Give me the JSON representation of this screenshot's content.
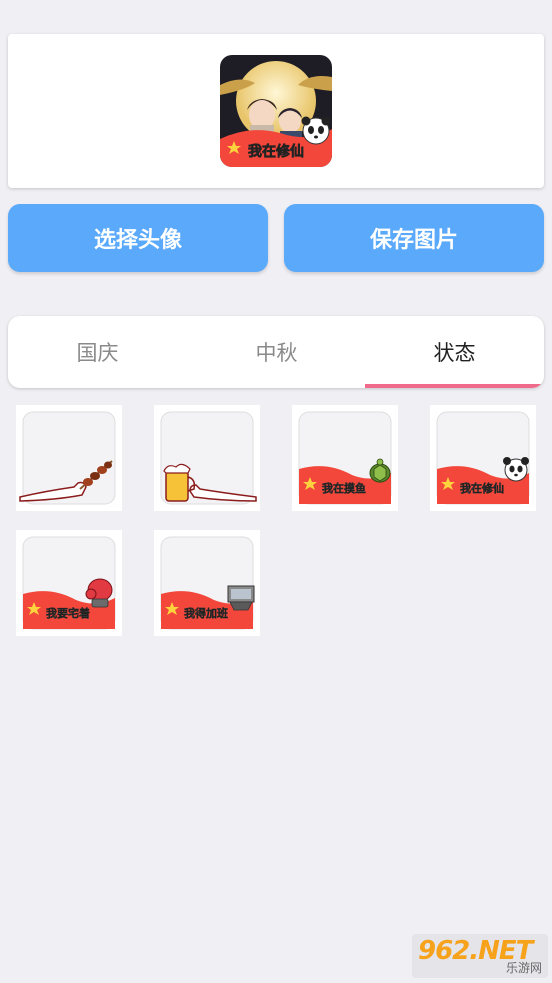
{
  "actions": {
    "choose_label": "选择头像",
    "save_label": "保存图片"
  },
  "tabs": [
    {
      "label": "国庆",
      "active": false
    },
    {
      "label": "中秋",
      "active": false
    },
    {
      "label": "状态",
      "active": true
    }
  ],
  "preview": {
    "frame_text": "我在修仙",
    "icon": "panda-icon"
  },
  "frames": [
    {
      "id": "skewer",
      "text": "",
      "icon": "skewer-icon"
    },
    {
      "id": "beer",
      "text": "",
      "icon": "beer-icon"
    },
    {
      "id": "turtle",
      "text": "我在摸鱼",
      "icon": "turtle-icon"
    },
    {
      "id": "panda",
      "text": "我在修仙",
      "icon": "panda-icon"
    },
    {
      "id": "boxing",
      "text": "我要宅着",
      "icon": "boxing-glove-icon"
    },
    {
      "id": "overtime",
      "text": "我得加班",
      "icon": "laptop-icon"
    }
  ],
  "watermark": {
    "main": "962.NET",
    "sub": "乐游网"
  },
  "colors": {
    "accent": "#5aa9fb",
    "tab_indicator": "#f06b8b",
    "flag_red": "#f2473a",
    "star": "#ffd33d"
  }
}
